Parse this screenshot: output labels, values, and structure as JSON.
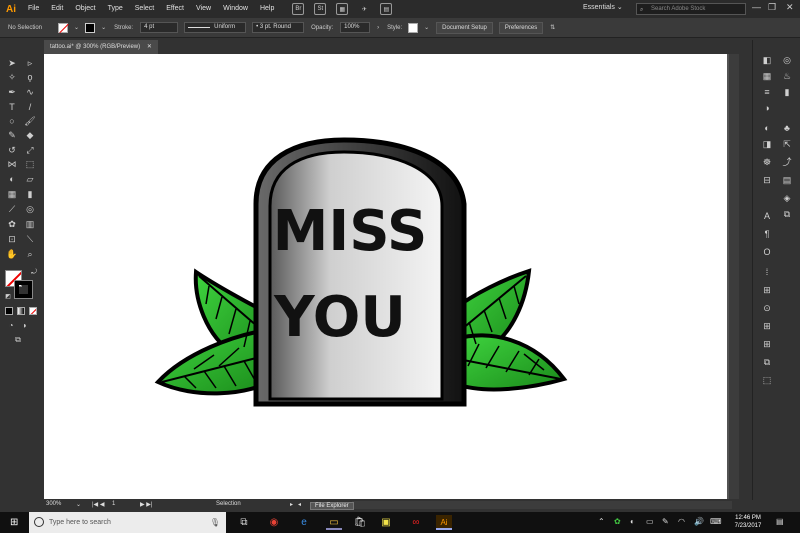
{
  "app": {
    "logo": "Ai",
    "menu": [
      "File",
      "Edit",
      "Object",
      "Type",
      "Select",
      "Effect",
      "View",
      "Window",
      "Help"
    ],
    "bridge_icons": [
      "Br",
      "St"
    ],
    "workspace": "Essentials",
    "stock_search_placeholder": "Search Adobe Stock",
    "window_controls": [
      "—",
      "❐",
      "✕"
    ]
  },
  "control_bar": {
    "selection_state": "No Selection",
    "stroke_label": "Stroke:",
    "stroke_value": "4 pt",
    "profile_value": "Uniform",
    "brush_value": "3 pt. Round",
    "opacity_label": "Opacity:",
    "opacity_value": "100%",
    "style_label": "Style:",
    "document_setup": "Document Setup",
    "preferences": "Preferences"
  },
  "document": {
    "tab_title": "tattoo.ai* @ 300% (RGB/Preview)",
    "artwork_text_line1": "MISS",
    "artwork_text_line2": "YOU"
  },
  "status": {
    "zoom": "300%",
    "artboard_num": "1",
    "tool": "Selection",
    "tooltip": "File Explorer"
  },
  "taskbar": {
    "search_placeholder": "Type here to search",
    "time": "12:46 PM",
    "date": "7/23/2017"
  },
  "colors": {
    "leaf_green": "#2cb52c",
    "leaf_dark": "#0d6b0d",
    "stone_light": "#f4f4f4",
    "stone_dark": "#5a5a5a",
    "illustrator_orange": "#ff9a00"
  }
}
